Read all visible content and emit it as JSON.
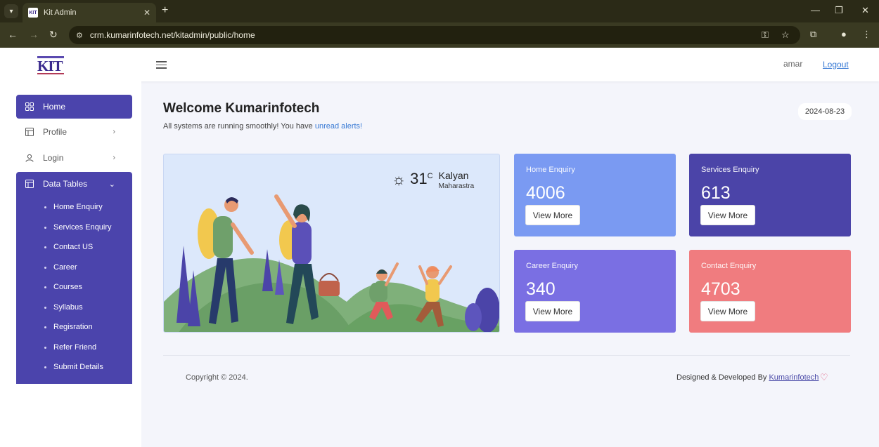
{
  "browser": {
    "tab_title": "Kit Admin",
    "tab_favicon_text": "KIT",
    "url": "crm.kumarinfotech.net/kitadmin/public/home"
  },
  "header": {
    "logo_text": "KIT",
    "user": "amar",
    "logout_label": "Logout"
  },
  "sidebar": {
    "items": [
      {
        "label": "Home",
        "icon": "grid-icon",
        "active": true
      },
      {
        "label": "Profile",
        "icon": "layout-icon"
      },
      {
        "label": "Login",
        "icon": "user-icon"
      }
    ],
    "data_tables": {
      "label": "Data Tables",
      "icon": "table-icon",
      "sub_items": [
        "Home Enquiry",
        "Services Enquiry",
        "Contact US",
        "Career",
        "Courses",
        "Syllabus",
        "Regisration",
        "Refer Friend",
        "Submit Details"
      ]
    }
  },
  "main": {
    "welcome": "Welcome Kumarinfotech",
    "subtext_prefix": "All systems are running smoothly! You have ",
    "subtext_link": "unread alerts!",
    "date": "2024-08-23",
    "weather": {
      "temp": "31",
      "unit": "C",
      "city": "Kalyan",
      "state": "Maharastra",
      "icon": "sun-icon"
    },
    "cards": [
      {
        "title": "Home Enquiry",
        "count": "4006",
        "button": "View More",
        "color": "#7a9af2"
      },
      {
        "title": "Services Enquiry",
        "count": "613",
        "button": "View More",
        "color": "#4b44a8"
      },
      {
        "title": "Career Enquiry",
        "count": "340",
        "button": "View More",
        "color": "#7a6fe3"
      },
      {
        "title": "Contact Enquiry",
        "count": "4703",
        "button": "View More",
        "color": "#f07c7f"
      }
    ]
  },
  "footer": {
    "copyright": "Copyright © 2024.",
    "designed_prefix": "Designed & Developed By ",
    "designed_link": "Kumarinfotech"
  }
}
